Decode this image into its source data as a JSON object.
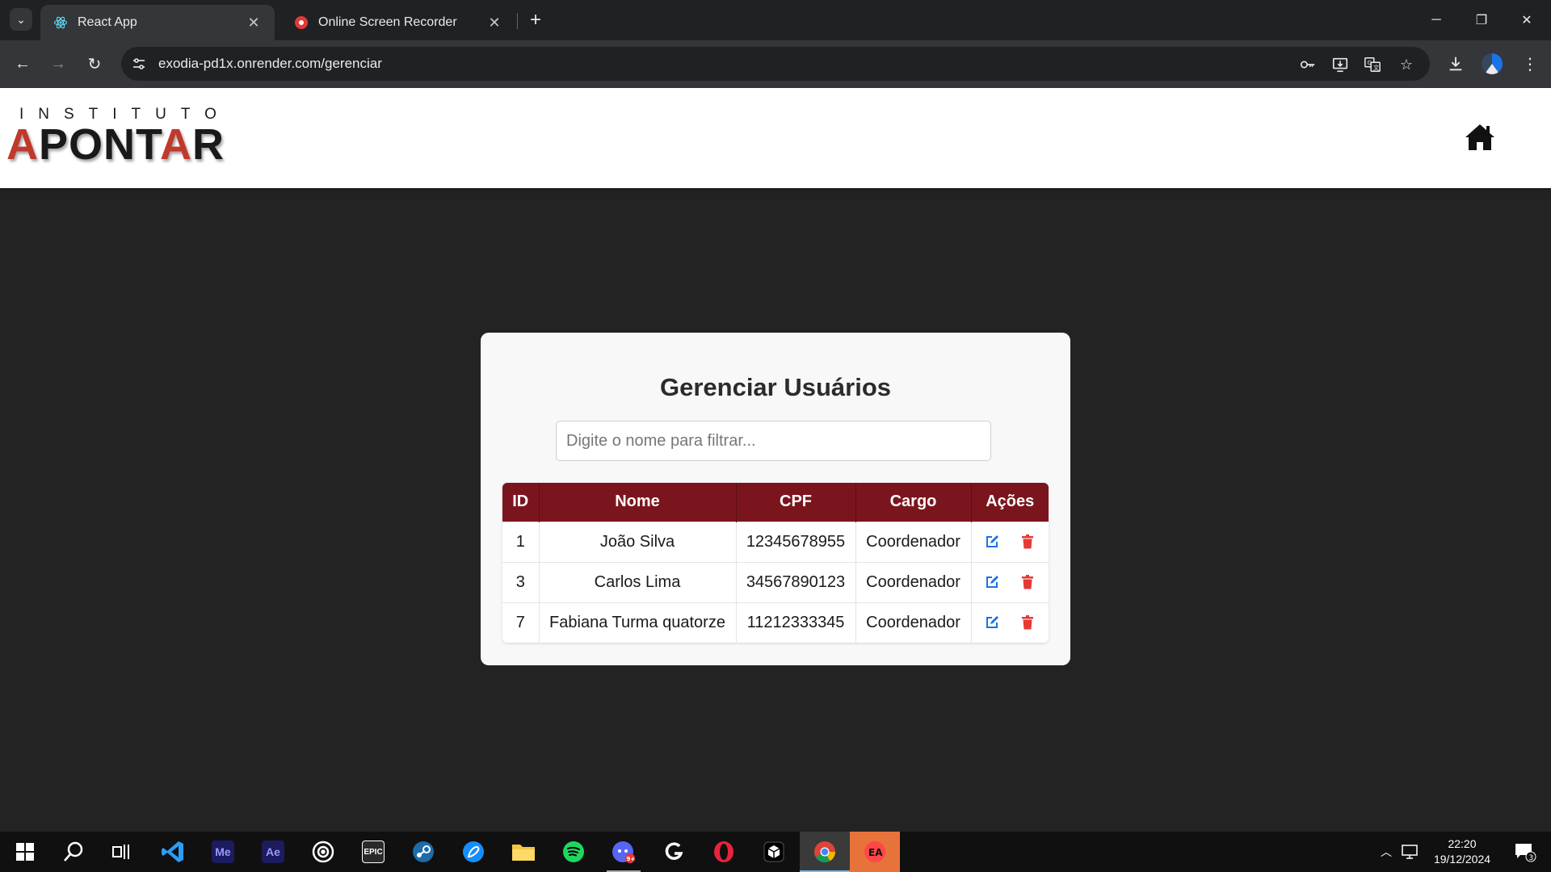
{
  "browser": {
    "tabs": [
      {
        "title": "React App",
        "active": true,
        "favicon": "react-icon"
      },
      {
        "title": "Online Screen Recorder",
        "active": false,
        "favicon": "record-icon"
      }
    ],
    "url": "exodia-pd1x.onrender.com/gerenciar"
  },
  "header": {
    "logo_small": "INSTITUTO",
    "logo_big_a1": "A",
    "logo_big_mid": "PONT",
    "logo_big_a2": "A",
    "logo_big_end": "R"
  },
  "main": {
    "title": "Gerenciar Usuários",
    "filter_placeholder": "Digite o nome para filtrar...",
    "columns": [
      "ID",
      "Nome",
      "CPF",
      "Cargo",
      "Ações"
    ],
    "rows": [
      {
        "id": "1",
        "nome": "João Silva",
        "cpf": "12345678955",
        "cargo": "Coordenador"
      },
      {
        "id": "3",
        "nome": "Carlos Lima",
        "cpf": "34567890123",
        "cargo": "Coordenador"
      },
      {
        "id": "7",
        "nome": "Fabiana Turma quatorze",
        "cpf": "11212333345",
        "cargo": "Coordenador"
      }
    ]
  },
  "taskbar": {
    "time": "22:20",
    "date": "19/12/2024",
    "notifications": "3",
    "apps": [
      {
        "name": "Me",
        "color": "#1c1b5e",
        "fg": "#9999ff"
      },
      {
        "name": "Ae",
        "color": "#1c1b5e",
        "fg": "#9999ff"
      },
      {
        "name": "EPIC",
        "color": "#2a2a2a",
        "fg": "#ffffff"
      }
    ],
    "discord_badge": "9+"
  },
  "colors": {
    "header_red": "#7b151d",
    "edit_blue": "#1a73e8",
    "delete_red": "#e53935"
  }
}
